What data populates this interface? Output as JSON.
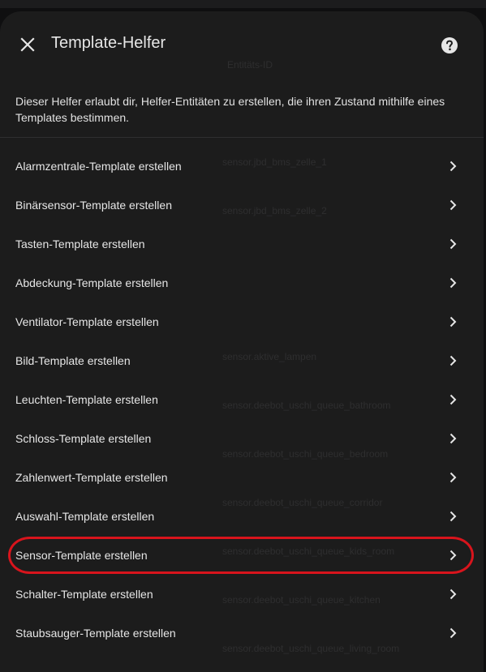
{
  "dialog": {
    "title": "Template-Helfer",
    "description": "Dieser Helfer erlaubt dir, Helfer-Entitäten zu erstellen, die ihren Zustand mithilfe eines Templates bestimmen."
  },
  "items": [
    {
      "label": "Alarmzentrale-Template erstellen"
    },
    {
      "label": "Binärsensor-Template erstellen"
    },
    {
      "label": "Tasten-Template erstellen"
    },
    {
      "label": "Abdeckung-Template erstellen"
    },
    {
      "label": "Ventilator-Template erstellen"
    },
    {
      "label": "Bild-Template erstellen"
    },
    {
      "label": "Leuchten-Template erstellen"
    },
    {
      "label": "Schloss-Template erstellen"
    },
    {
      "label": "Zahlenwert-Template erstellen"
    },
    {
      "label": "Auswahl-Template erstellen"
    },
    {
      "label": "Sensor-Template erstellen"
    },
    {
      "label": "Schalter-Template erstellen"
    },
    {
      "label": "Staubsauger-Template erstellen"
    }
  ],
  "background": {
    "column_header": "Entitäts-ID",
    "entities": [
      "sensor.jbd_bms_zelle_1",
      "sensor.jbd_bms_zelle_2",
      "sensor.aktive_lampen",
      "sensor.deebot_uschi_queue_bathroom",
      "sensor.deebot_uschi_queue_bedroom",
      "sensor.deebot_uschi_queue_corridor",
      "sensor.deebot_uschi_queue_kids_room",
      "sensor.deebot_uschi_queue_kitchen",
      "sensor.deebot_uschi_queue_living_room"
    ]
  },
  "colors": {
    "dialog_bg": "#1c1c1c",
    "text": "#e6e6e6",
    "highlight": "#d8141c"
  },
  "icons": {
    "close": "close-icon",
    "help": "help-circle-icon",
    "chevron": "chevron-right-icon"
  }
}
